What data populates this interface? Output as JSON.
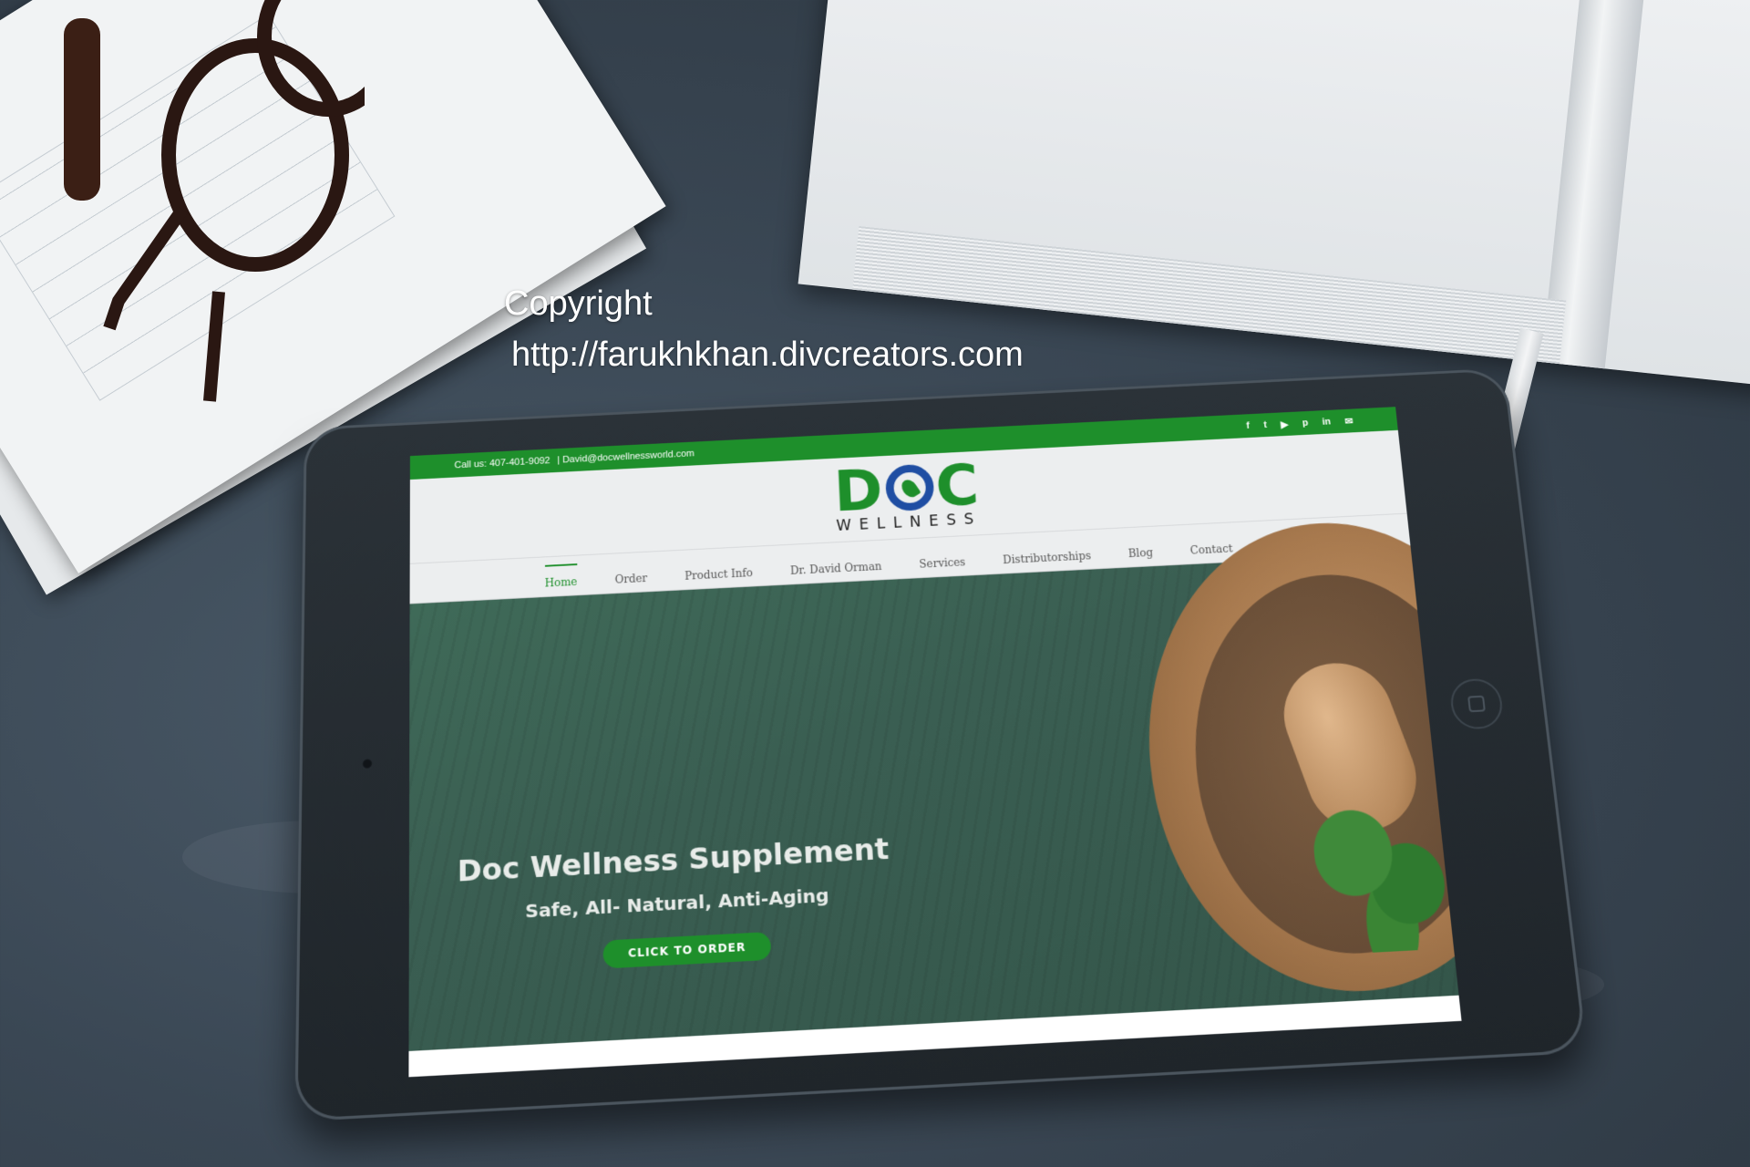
{
  "watermark": {
    "line1": "Copyright",
    "line2": "http://farukhkhan.divcreators.com"
  },
  "site": {
    "topbar": {
      "contact": "Call us: 407-401-9092",
      "email": "| David@docwellnessworld.com",
      "social_icons": [
        "facebook-icon",
        "twitter-icon",
        "youtube-icon",
        "pinterest-icon",
        "linkedin-icon",
        "mail-icon"
      ]
    },
    "logo": {
      "left": "D",
      "right": "C",
      "sub": "WELLNESS"
    },
    "nav": [
      {
        "label": "Home",
        "active": true
      },
      {
        "label": "Order"
      },
      {
        "label": "Product Info"
      },
      {
        "label": "Dr. David Orman"
      },
      {
        "label": "Services"
      },
      {
        "label": "Distributorships"
      },
      {
        "label": "Blog"
      },
      {
        "label": "Contact"
      }
    ],
    "hero": {
      "title": "Doc Wellness Supplement",
      "subtitle": "Safe, All- Natural, Anti-Aging",
      "cta": "CLICK TO ORDER"
    }
  },
  "colors": {
    "brand_green": "#1e8f2b",
    "brand_blue": "#1f4ea3"
  }
}
